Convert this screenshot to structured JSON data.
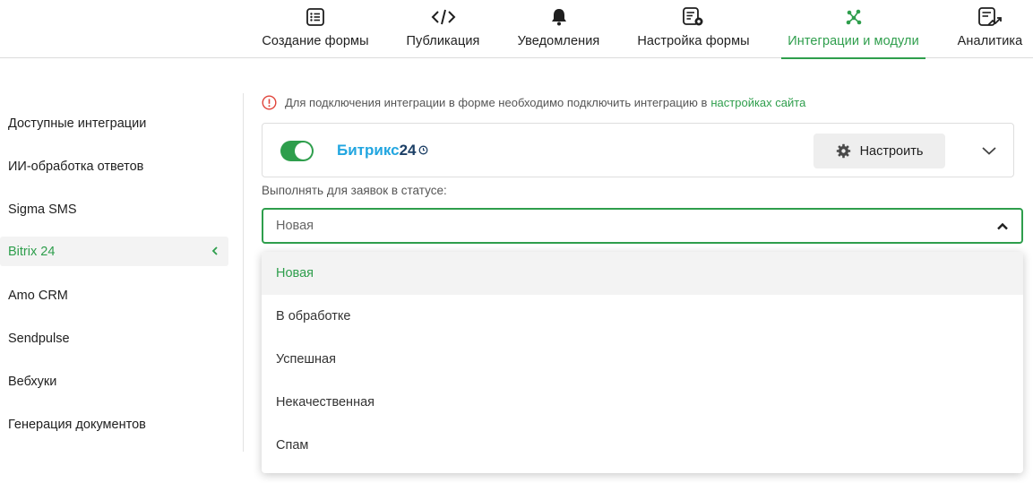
{
  "nav": {
    "tabs": [
      {
        "label": "Создание формы",
        "icon": "form-list-icon"
      },
      {
        "label": "Публикация",
        "icon": "code-icon"
      },
      {
        "label": "Уведомления",
        "icon": "bell-icon"
      },
      {
        "label": "Настройка формы",
        "icon": "form-settings-icon"
      },
      {
        "label": "Интеграции и модули",
        "icon": "integrations-icon"
      },
      {
        "label": "Аналитика",
        "icon": "analytics-icon"
      }
    ],
    "active_tab": "Интеграции и модули"
  },
  "sidebar": {
    "items": [
      {
        "label": "Доступные интеграции"
      },
      {
        "label": "ИИ-обработка ответов"
      },
      {
        "label": "Sigma SMS"
      },
      {
        "label": "Bitrix 24"
      },
      {
        "label": "Amo CRM"
      },
      {
        "label": "Sendpulse"
      },
      {
        "label": "Вебхуки"
      },
      {
        "label": "Генерация документов"
      }
    ],
    "active_item": "Bitrix 24"
  },
  "notice": {
    "text": "Для подключения интеграции в форме необходимо подключить интеграцию в",
    "link": "настройках сайта"
  },
  "integration": {
    "logo_part1": "Битрикс",
    "logo_part2": "24",
    "enabled": true,
    "configure_label": "Настроить"
  },
  "status_filter": {
    "label": "Выполнять для заявок в статусе:",
    "selected": "Новая",
    "options": [
      "Новая",
      "В обработке",
      "Успешная",
      "Некачественная",
      "Спам"
    ]
  },
  "colors": {
    "accent": "#2e9e4c",
    "bitrix_blue": "#22a6e0",
    "bitrix_dark": "#1c3f66",
    "error": "#e0443a"
  }
}
